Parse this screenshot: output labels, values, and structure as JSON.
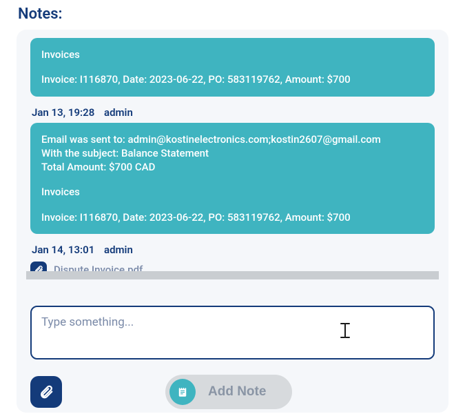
{
  "header": {
    "title": "Notes:"
  },
  "notes": [
    {
      "lines": [
        "Invoices",
        "",
        "Invoice: I116870, Date: 2023-06-22, PO: 583119762, Amount: $700"
      ]
    },
    {
      "meta": {
        "timestamp": "Jan 13, 19:28",
        "user": "admin"
      },
      "lines": [
        "Email was sent to: admin@kostinelectronics.com;kostin2607@gmail.com",
        "With the subject: Balance Statement",
        "Total Amount: $700 CAD",
        "",
        "Invoices",
        "",
        "Invoice: I116870, Date: 2023-06-22, PO: 583119762, Amount: $700"
      ]
    },
    {
      "meta": {
        "timestamp": "Jan 14, 13:01",
        "user": "admin"
      },
      "attachment": {
        "filename": "Dispute Invoice.pdf"
      }
    }
  ],
  "composer": {
    "placeholder": "Type something...",
    "attach_label": "Attach file",
    "add_note_label": "Add Note"
  }
}
